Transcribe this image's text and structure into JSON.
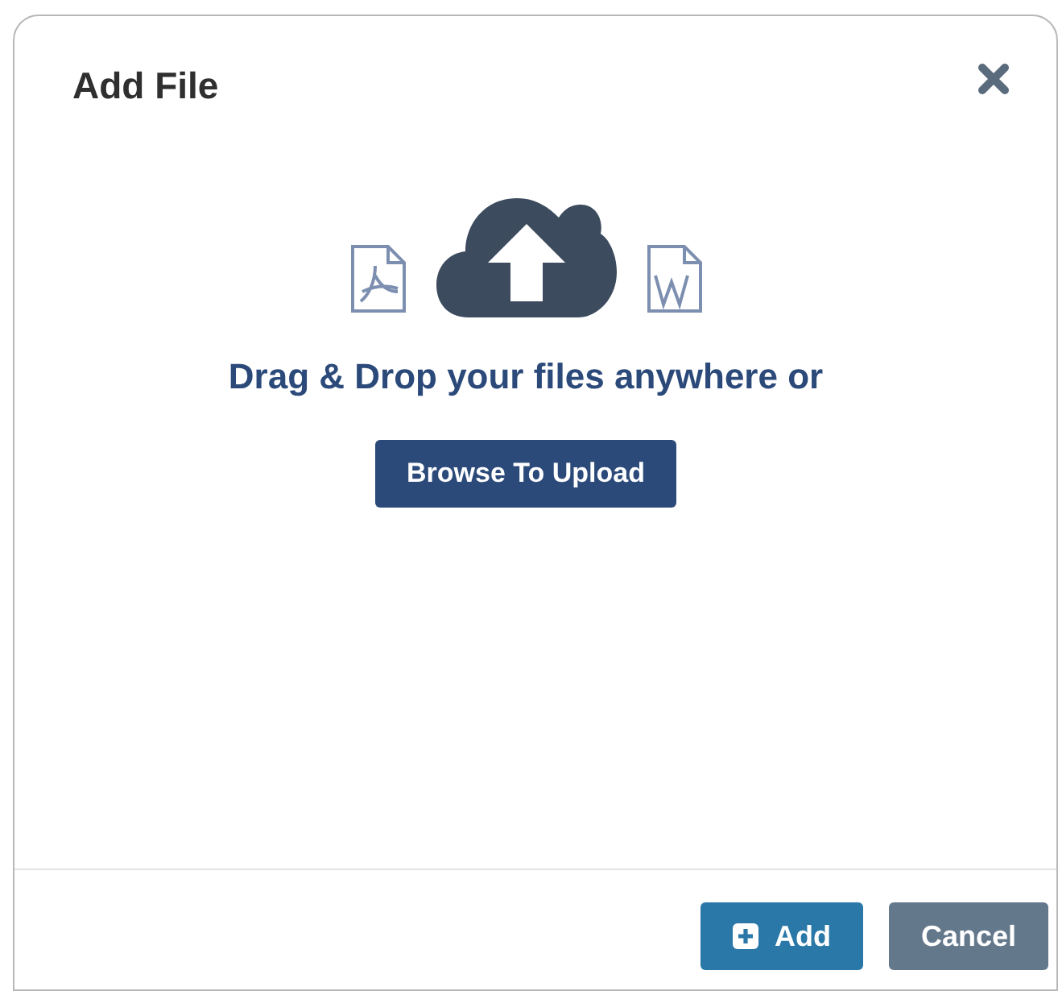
{
  "dialog": {
    "title": "Add File"
  },
  "dropzone": {
    "prompt": "Drag & Drop your files anywhere or",
    "browse_button": "Browse To Upload"
  },
  "footer": {
    "buttons": [
      {
        "label": "Add",
        "kind": "primary"
      },
      {
        "label": "Cancel",
        "kind": "secondary"
      }
    ]
  }
}
